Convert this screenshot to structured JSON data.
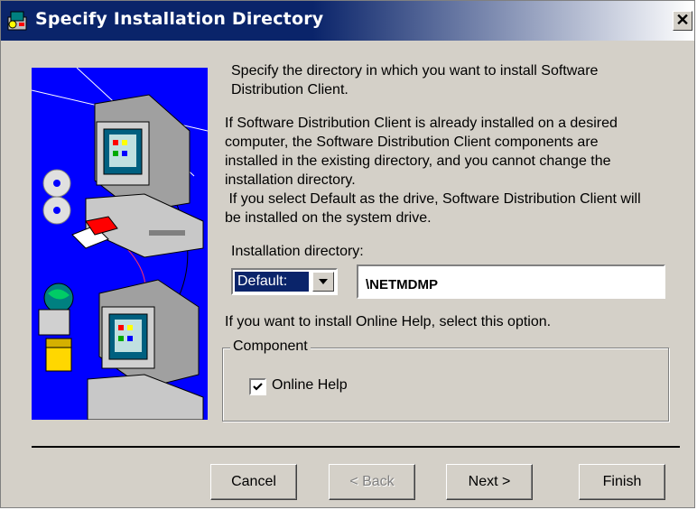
{
  "window": {
    "title": "Specify Installation Directory",
    "close_label": "✕"
  },
  "text": {
    "intro_line1": "Specify the directory in which you want to install Software",
    "intro_line2": "Distribution Client.",
    "info_line1": "If Software Distribution Client is already installed on a desired",
    "info_line2": "computer, the Software Distribution Client components are",
    "info_line3": "installed in the existing directory, and you cannot change the",
    "info_line4": "installation directory.",
    "default_line1": " If you select Default as the drive, Software Distribution Client will",
    "default_line2": "be installed on the system drive."
  },
  "install_dir": {
    "label": "Installation directory:",
    "drive_selected": "Default:",
    "path_value": "\\NETMDMP"
  },
  "help_prompt": "If you want to install Online Help, select this option.",
  "component": {
    "group_label": "Component",
    "online_help_label": "Online Help",
    "online_help_checked": true
  },
  "buttons": {
    "cancel": "Cancel",
    "back": "< Back",
    "next": "Next >",
    "finish": "Finish"
  },
  "colors": {
    "title_bar": "#0a246a",
    "dialog_bg": "#d4d0c8",
    "illustration_bg": "#0000ff"
  }
}
